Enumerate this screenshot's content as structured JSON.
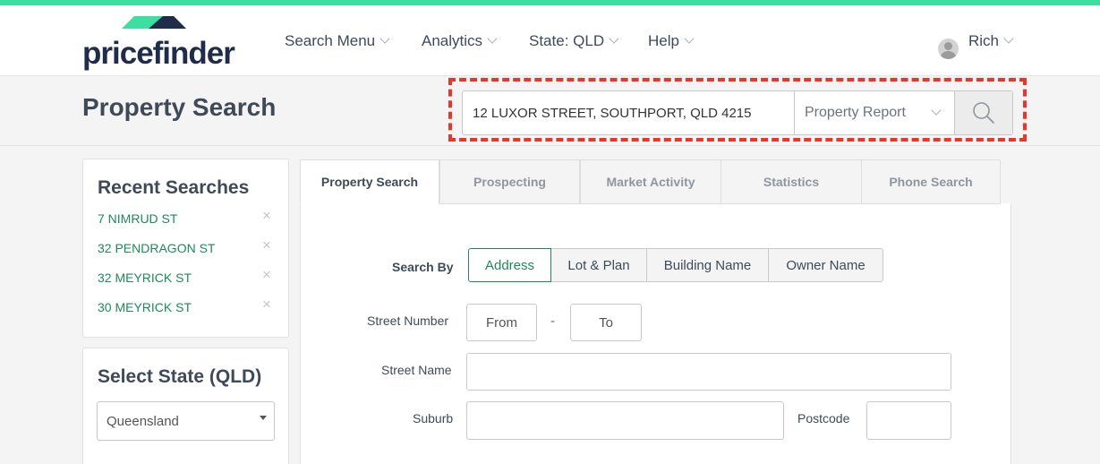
{
  "brand": {
    "name": "pricefinder",
    "accent": "#3ddfa0",
    "dark": "#1f2d4a",
    "link_color": "#1d8a5a",
    "highlight_color": "#e8362a"
  },
  "nav": {
    "search_menu": "Search Menu",
    "analytics": "Analytics",
    "state": "State: QLD",
    "help": "Help",
    "user": "Rich"
  },
  "page_title": "Property Search",
  "quick_search": {
    "value": "12 LUXOR STREET, SOUTHPORT, QLD 4215",
    "report_type": "Property Report",
    "search_icon": "search-icon"
  },
  "recent": {
    "title": "Recent Searches",
    "items": [
      "7 NIMRUD ST",
      "32 PENDRAGON ST",
      "32 MEYRICK ST",
      "30 MEYRICK ST"
    ],
    "remove_icon": "close-icon"
  },
  "state_panel": {
    "title": "Select State (QLD)",
    "selected": "Queensland"
  },
  "tabs": [
    "Property Search",
    "Prospecting",
    "Market Activity",
    "Statistics",
    "Phone Search"
  ],
  "form": {
    "search_by_label": "Search By",
    "search_by_options": [
      "Address",
      "Lot & Plan",
      "Building Name",
      "Owner Name"
    ],
    "street_number_label": "Street Number",
    "from_placeholder": "From",
    "to_placeholder": "To",
    "dash": "-",
    "street_name_label": "Street Name",
    "suburb_label": "Suburb",
    "postcode_label": "Postcode"
  }
}
